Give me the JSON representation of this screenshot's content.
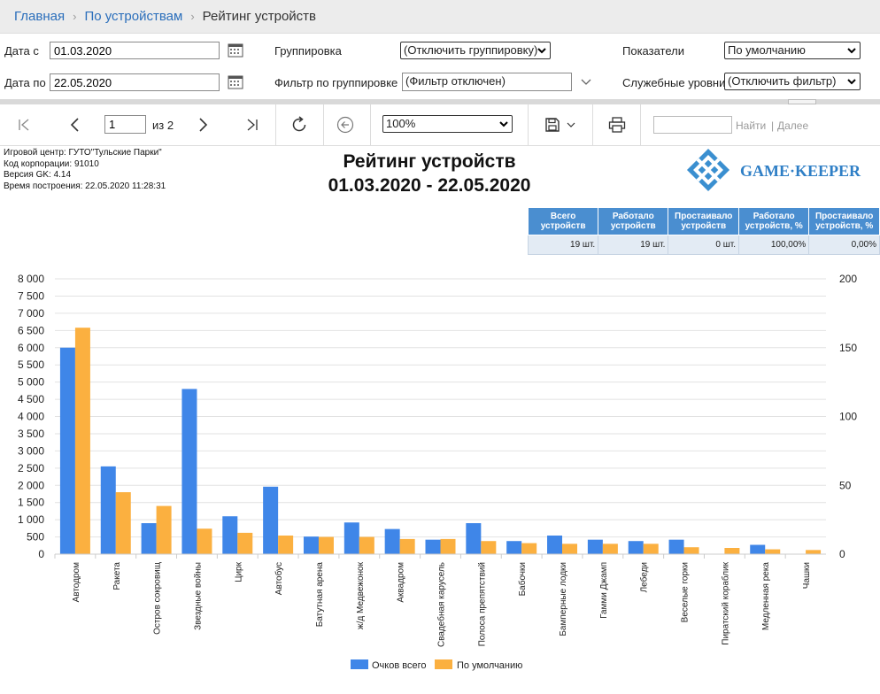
{
  "breadcrumb": {
    "home": "Главная",
    "devices": "По устройствам",
    "current": "Рейтинг устройств"
  },
  "filters": {
    "date_from_label": "Дата с",
    "date_from": "01.03.2020",
    "date_to_label": "Дата по",
    "date_to": "22.05.2020",
    "grouping_label": "Группировка",
    "grouping_value": "(Отключить группировку)",
    "group_filter_label": "Фильтр по группировке",
    "group_filter_value": "(Фильтр отключен)",
    "indicators_label": "Показатели",
    "indicators_value": "По умолчанию",
    "service_levels_label": "Служебные уровни",
    "service_levels_value": "(Отключить фильтр)"
  },
  "toolbar": {
    "page": "1",
    "of_pages": "из 2",
    "zoom": "100%",
    "find_label": "Найти",
    "next_label": "Далее",
    "find_sep": "|"
  },
  "report": {
    "meta": [
      "Игровой центр: ГУТО\"Тульские Парки\"",
      "Код корпорации: 91010",
      "Версия GK: 4.14",
      "Время построения: 22.05.2020 11:28:31"
    ],
    "title_line1": "Рейтинг устройств",
    "title_line2": "01.03.2020 - 22.05.2020",
    "logo_text": "GAME·KEEPER",
    "stats_headers": [
      "Всего устройств",
      "Работало устройств",
      "Простаивало устройств",
      "Работало устройств, %",
      "Простаивало устройств, %"
    ],
    "stats_values": [
      "19 шт.",
      "19 шт.",
      "0 шт.",
      "100,00%",
      "0,00%"
    ]
  },
  "chart_data": {
    "type": "bar",
    "categories": [
      "Автодром",
      "Ракета",
      "Остров сокровищ",
      "Звездные войны",
      "Цирк",
      "Автобус",
      "Батутная арена",
      "ж/д Медвежонок",
      "Аквадром",
      "Свадебная карусель",
      "Полоса препятствий",
      "Бабочки",
      "Бамперные лодки",
      "Гамми Джамп",
      "Лебеди",
      "Веселые горки",
      "Пиратский кораблик",
      "Медленная река",
      "Чашки"
    ],
    "series": [
      {
        "name": "Очков всего",
        "axis": "left",
        "color": "#3f86e8",
        "values": [
          6000,
          2550,
          900,
          4800,
          1100,
          1960,
          510,
          920,
          730,
          420,
          900,
          380,
          540,
          420,
          380,
          420,
          0,
          270,
          0
        ]
      },
      {
        "name": "По умолчанию",
        "axis": "right",
        "color": "#fbb040",
        "values": [
          164.5,
          45,
          35,
          18.5,
          15.5,
          13.5,
          12.5,
          12.5,
          11,
          11,
          9.5,
          8,
          7.5,
          7.5,
          7.5,
          5,
          4.5,
          3.5,
          3
        ]
      }
    ],
    "ylim_left": [
      0,
      8000
    ],
    "yticks_left": [
      "0",
      "500",
      "1 000",
      "1 500",
      "2 000",
      "2 500",
      "3 000",
      "3 500",
      "4 000",
      "4 500",
      "5 000",
      "5 500",
      "6 000",
      "6 500",
      "7 000",
      "7 500",
      "8 000"
    ],
    "ylim_right": [
      0,
      200
    ],
    "yticks_right": [
      "0",
      "50",
      "100",
      "150",
      "200"
    ],
    "grid": true,
    "legend_position": "bottom"
  }
}
